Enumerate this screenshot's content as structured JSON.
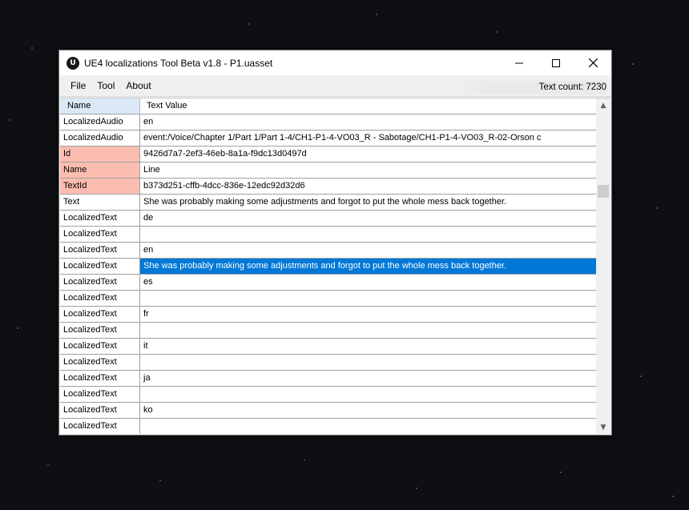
{
  "window": {
    "title": "UE4 localizations Tool Beta v1.8 - P1.uasset",
    "app_icon": "U",
    "icons": {
      "minimize": "minimize-icon",
      "maximize": "maximize-icon",
      "close": "close-icon"
    }
  },
  "menu": {
    "items": [
      "File",
      "Tool",
      "About"
    ],
    "text_count": "Text count: 7230"
  },
  "grid": {
    "columns": [
      "Name",
      "Text Value"
    ],
    "rows": [
      {
        "name": "LocalizedAudio",
        "value": "en"
      },
      {
        "name": "LocalizedAudio",
        "value": "event:/Voice/Chapter 1/Part 1/Part 1-4/CH1-P1-4-VO03_R - Sabotage/CH1-P1-4-VO03_R-02-Orson c"
      },
      {
        "name": "Id",
        "value": "9426d7a7-2ef3-46eb-8a1a-f9dc13d0497d"
      },
      {
        "name": "Name",
        "value": "Line"
      },
      {
        "name": "TextId",
        "value": "b373d251-cffb-4dcc-836e-12edc92d32d6"
      },
      {
        "name": "Text",
        "value": "She was probably making some adjustments and forgot to put the whole mess back together."
      },
      {
        "name": "LocalizedText",
        "value": "de"
      },
      {
        "name": "LocalizedText",
        "value": ""
      },
      {
        "name": "LocalizedText",
        "value": "en"
      },
      {
        "name": "LocalizedText",
        "value": "She was probably making some adjustments and forgot to put the whole mess back together."
      },
      {
        "name": "LocalizedText",
        "value": "es"
      },
      {
        "name": "LocalizedText",
        "value": ""
      },
      {
        "name": "LocalizedText",
        "value": "fr"
      },
      {
        "name": "LocalizedText",
        "value": ""
      },
      {
        "name": "LocalizedText",
        "value": "it"
      },
      {
        "name": "LocalizedText",
        "value": ""
      },
      {
        "name": "LocalizedText",
        "value": "ja"
      },
      {
        "name": "LocalizedText",
        "value": ""
      },
      {
        "name": "LocalizedText",
        "value": "ko"
      },
      {
        "name": "LocalizedText",
        "value": ""
      }
    ],
    "highlighted_rows": [
      2,
      3,
      4
    ],
    "selected_row": 9,
    "colors": {
      "highlight": "#fbbdb0",
      "selection": "#0078d7",
      "header": "#dbe9f7"
    }
  },
  "scrollbar": {
    "up_icon": "scroll-up-icon",
    "down_icon": "scroll-down-icon"
  }
}
